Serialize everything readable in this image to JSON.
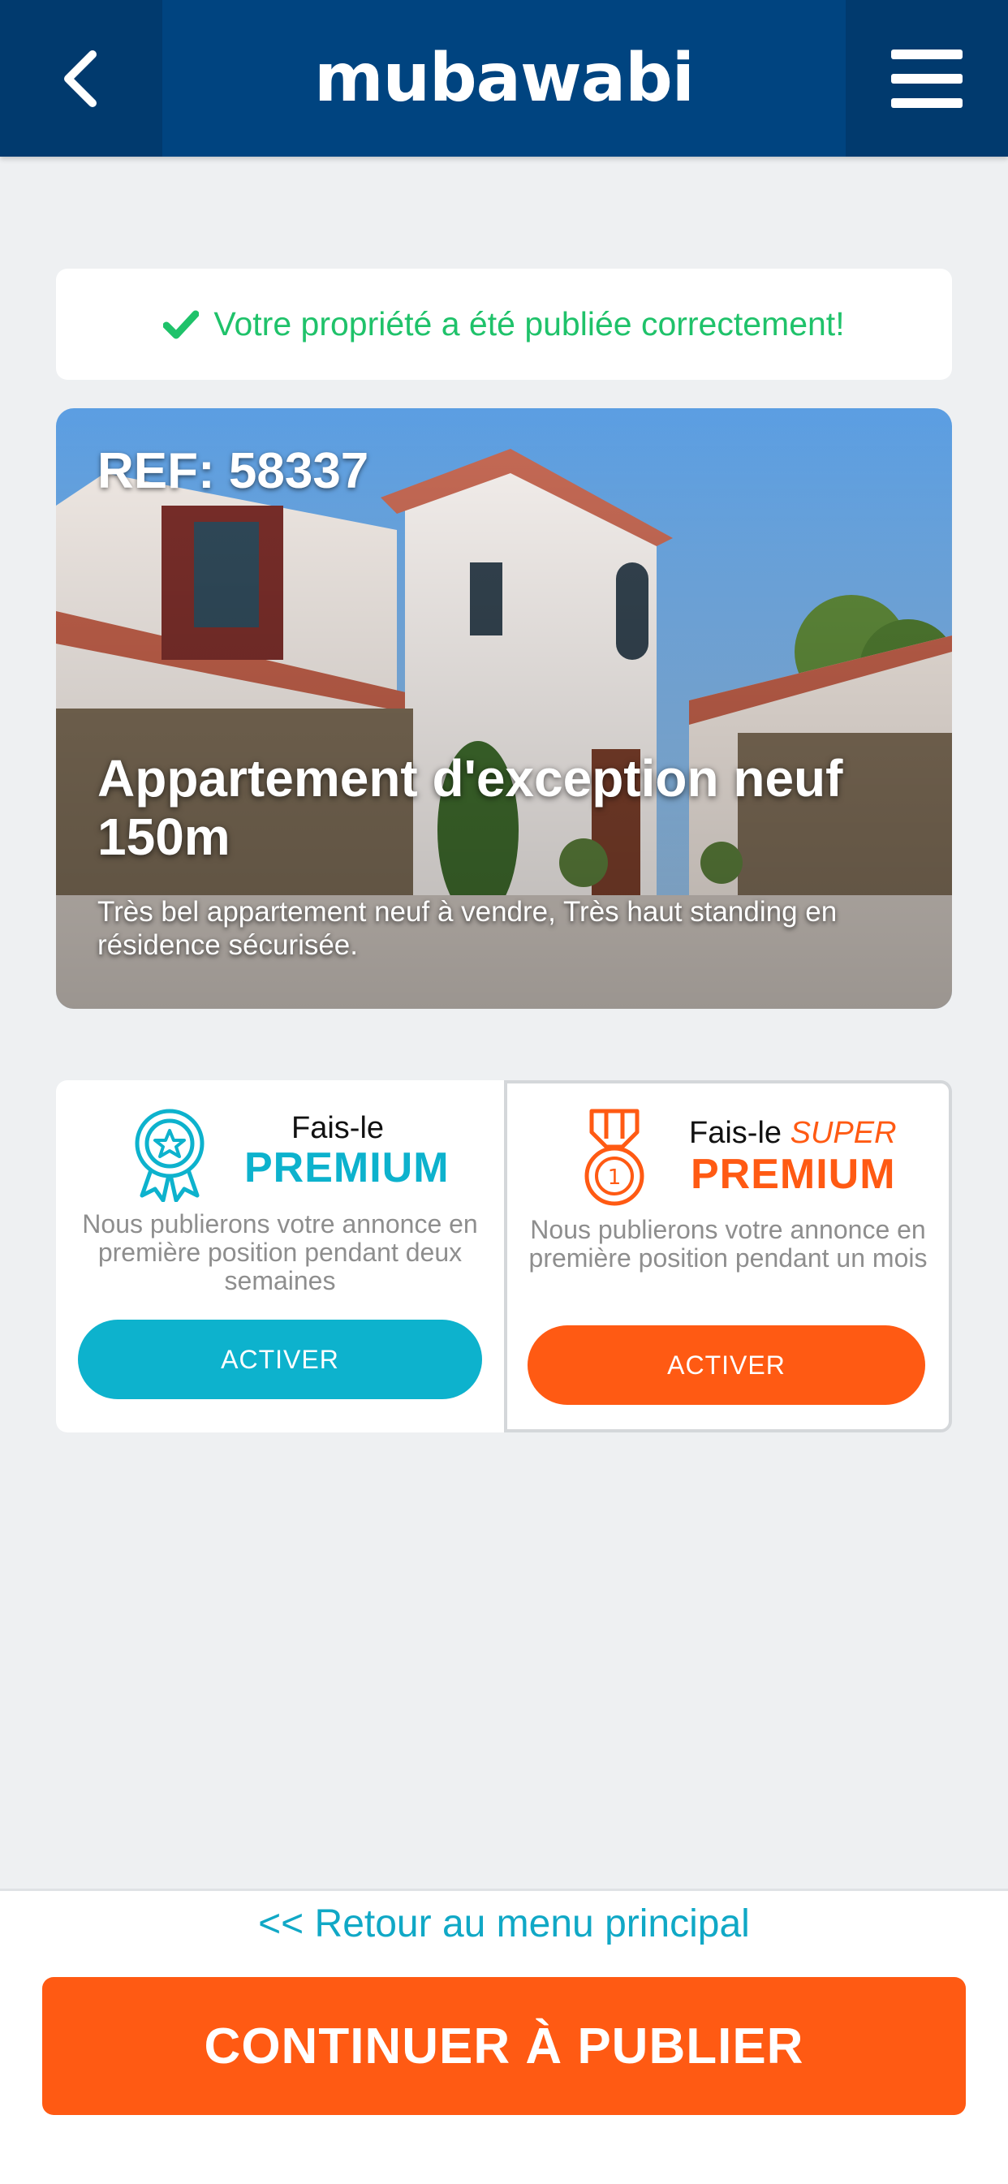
{
  "header": {
    "logo": "mubawabi",
    "back_icon": "chevron-left-icon",
    "menu_icon": "hamburger-menu-icon"
  },
  "success": {
    "icon": "checkmark-icon",
    "message": "Votre propriété a été publiée correctement!"
  },
  "listing": {
    "ref": "REF: 58337",
    "title": "Appartement d'exception neuf 150m",
    "description": "Très bel appartement neuf à vendre, Très haut standing en résidence sécurisée."
  },
  "offers": {
    "premium": {
      "icon": "ribbon-badge-icon",
      "title_prefix": "Fais-le",
      "title_main": "PREMIUM",
      "description": "Nous publierons votre annonce en première position pendant deux semaines",
      "button": "ACTIVER",
      "color": "#0db2cd"
    },
    "super": {
      "icon": "medal-icon",
      "title_prefix": "Fais-le",
      "title_super": "SUPER",
      "title_main": "PREMIUM",
      "description": "Nous publierons votre annonce en première position pendant un mois",
      "button": "ACTIVER",
      "color": "#ff5a13"
    }
  },
  "footer": {
    "back_link": "<< Retour au menu principal",
    "continue_button": "CONTINUER À PUBLIER"
  },
  "colors": {
    "header": "#004480",
    "header_side": "#013a6e",
    "success": "#1fc26a",
    "accent_blue": "#0db2cd",
    "accent_orange": "#ff5a13",
    "background": "#eef0f2"
  }
}
